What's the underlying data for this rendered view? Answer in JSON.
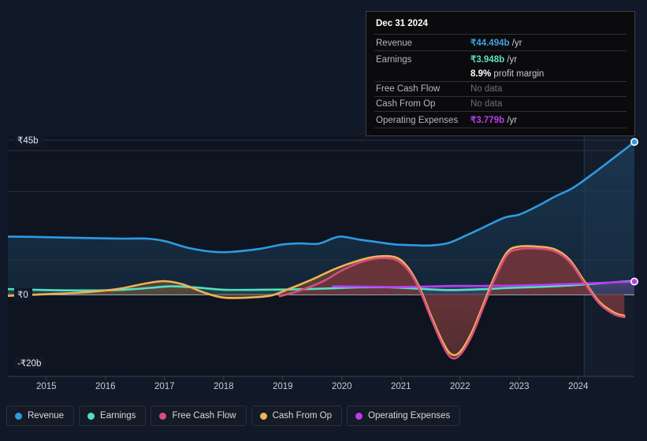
{
  "tooltip": {
    "date": "Dec 31 2024",
    "rows": [
      {
        "label": "Revenue",
        "value": "₹44.494b",
        "unit": "/yr",
        "color": "#3ea0e0",
        "nodata": false
      },
      {
        "label": "Earnings",
        "value": "₹3.948b",
        "unit": "/yr",
        "color": "#5fe0c0",
        "nodata": false
      },
      {
        "label": "",
        "value": "8.9%",
        "unit": "profit margin",
        "color": "#ffffff",
        "nodata": false
      },
      {
        "label": "Free Cash Flow",
        "value": "No data",
        "unit": "",
        "color": "#6b7079",
        "nodata": true
      },
      {
        "label": "Cash From Op",
        "value": "No data",
        "unit": "",
        "color": "#6b7079",
        "nodata": true
      },
      {
        "label": "Operating Expenses",
        "value": "₹3.779b",
        "unit": "/yr",
        "color": "#b83df0",
        "nodata": false
      }
    ]
  },
  "legend": [
    {
      "label": "Revenue",
      "color": "#2e9ae0"
    },
    {
      "label": "Earnings",
      "color": "#4fe0c4"
    },
    {
      "label": "Free Cash Flow",
      "color": "#d44d7d"
    },
    {
      "label": "Cash From Op",
      "color": "#f0b254"
    },
    {
      "label": "Operating Expenses",
      "color": "#b83df0"
    }
  ],
  "chart_data": {
    "type": "area",
    "title": "",
    "xlabel": "",
    "ylabel": "",
    "currency": "₹",
    "unit": "b",
    "ylim": [
      -20,
      45
    ],
    "yticks": [
      {
        "label": "₹45b",
        "value": 45
      },
      {
        "label": "₹0",
        "value": 0
      },
      {
        "label": "-₹20b",
        "value": -20
      }
    ],
    "gridlines": [
      45,
      42,
      30,
      10,
      0
    ],
    "xlim": [
      2014.35,
      2024.95
    ],
    "xticks": [
      "2015",
      "2016",
      "2017",
      "2018",
      "2019",
      "2020",
      "2021",
      "2022",
      "2023",
      "2024"
    ],
    "legend_position": "bottom",
    "grid": true,
    "highlight_region": {
      "from": 2024.1,
      "to": 2024.95
    },
    "series": [
      {
        "name": "Revenue",
        "color": "#2e9ae0",
        "fill": "#1b3a55",
        "end_marker": true,
        "end_value": 44.494,
        "points": [
          [
            2014.35,
            16.9
          ],
          [
            2014.8,
            16.8
          ],
          [
            2015.3,
            16.6
          ],
          [
            2015.9,
            16.4
          ],
          [
            2016.3,
            16.3
          ],
          [
            2016.7,
            16.3
          ],
          [
            2017.0,
            15.6
          ],
          [
            2017.4,
            13.6
          ],
          [
            2017.8,
            12.5
          ],
          [
            2018.1,
            12.4
          ],
          [
            2018.6,
            13.3
          ],
          [
            2019.0,
            14.6
          ],
          [
            2019.3,
            14.9
          ],
          [
            2019.6,
            14.8
          ],
          [
            2019.85,
            16.4
          ],
          [
            2020.0,
            16.9
          ],
          [
            2020.3,
            16.0
          ],
          [
            2020.6,
            15.3
          ],
          [
            2020.9,
            14.6
          ],
          [
            2021.2,
            14.4
          ],
          [
            2021.5,
            14.3
          ],
          [
            2021.8,
            15.0
          ],
          [
            2022.1,
            17.2
          ],
          [
            2022.4,
            19.6
          ],
          [
            2022.75,
            22.4
          ],
          [
            2023.0,
            23.3
          ],
          [
            2023.3,
            25.7
          ],
          [
            2023.6,
            28.5
          ],
          [
            2023.9,
            31.0
          ],
          [
            2024.2,
            34.6
          ],
          [
            2024.5,
            38.5
          ],
          [
            2024.75,
            41.8
          ],
          [
            2024.95,
            44.494
          ]
        ]
      },
      {
        "name": "Earnings",
        "color": "#4fe0c4",
        "fill": "#2a5a52",
        "points": [
          [
            2014.35,
            1.6
          ],
          [
            2015.0,
            1.3
          ],
          [
            2015.6,
            1.2
          ],
          [
            2016.2,
            1.3
          ],
          [
            2016.8,
            2.0
          ],
          [
            2017.1,
            2.4
          ],
          [
            2017.5,
            2.1
          ],
          [
            2018.0,
            1.4
          ],
          [
            2018.6,
            1.4
          ],
          [
            2019.2,
            1.5
          ],
          [
            2019.8,
            1.8
          ],
          [
            2020.3,
            2.1
          ],
          [
            2020.8,
            2.1
          ],
          [
            2021.3,
            1.7
          ],
          [
            2021.8,
            1.3
          ],
          [
            2022.3,
            1.5
          ],
          [
            2022.8,
            1.9
          ],
          [
            2023.3,
            2.2
          ],
          [
            2023.8,
            2.6
          ],
          [
            2024.3,
            3.2
          ],
          [
            2024.7,
            3.7
          ],
          [
            2024.95,
            3.948
          ]
        ]
      },
      {
        "name": "Free Cash Flow",
        "color": "#d44d7d",
        "fill": "#6e2f3c",
        "points": [
          [
            2018.95,
            -0.5
          ],
          [
            2019.3,
            1.2
          ],
          [
            2019.7,
            4.0
          ],
          [
            2020.0,
            7.0
          ],
          [
            2020.35,
            9.6
          ],
          [
            2020.65,
            10.6
          ],
          [
            2020.9,
            10.2
          ],
          [
            2021.1,
            7.6
          ],
          [
            2021.3,
            2.0
          ],
          [
            2021.5,
            -6.5
          ],
          [
            2021.7,
            -14.5
          ],
          [
            2021.85,
            -18.4
          ],
          [
            2022.0,
            -17.6
          ],
          [
            2022.2,
            -12.0
          ],
          [
            2022.4,
            -3.5
          ],
          [
            2022.6,
            5.0
          ],
          [
            2022.8,
            11.6
          ],
          [
            2023.0,
            13.2
          ],
          [
            2023.3,
            13.4
          ],
          [
            2023.6,
            12.6
          ],
          [
            2023.85,
            9.6
          ],
          [
            2024.1,
            3.5
          ],
          [
            2024.35,
            -2.5
          ],
          [
            2024.6,
            -5.7
          ],
          [
            2024.78,
            -6.6
          ]
        ]
      },
      {
        "name": "Cash From Op",
        "color": "#f0b254",
        "fill": "#6b4a33",
        "points": [
          [
            2014.35,
            -0.4
          ],
          [
            2015.0,
            0.1
          ],
          [
            2015.6,
            0.6
          ],
          [
            2016.2,
            1.6
          ],
          [
            2016.7,
            3.3
          ],
          [
            2017.0,
            3.9
          ],
          [
            2017.3,
            3.0
          ],
          [
            2017.7,
            0.4
          ],
          [
            2018.0,
            -0.9
          ],
          [
            2018.4,
            -0.9
          ],
          [
            2018.8,
            -0.3
          ],
          [
            2019.1,
            1.6
          ],
          [
            2019.5,
            4.4
          ],
          [
            2019.9,
            7.6
          ],
          [
            2020.3,
            10.0
          ],
          [
            2020.6,
            11.1
          ],
          [
            2020.9,
            10.9
          ],
          [
            2021.1,
            8.3
          ],
          [
            2021.3,
            2.6
          ],
          [
            2021.5,
            -5.8
          ],
          [
            2021.7,
            -13.6
          ],
          [
            2021.85,
            -17.4
          ],
          [
            2022.0,
            -16.7
          ],
          [
            2022.2,
            -11.0
          ],
          [
            2022.4,
            -2.6
          ],
          [
            2022.6,
            5.9
          ],
          [
            2022.8,
            12.4
          ],
          [
            2023.0,
            14.0
          ],
          [
            2023.3,
            14.0
          ],
          [
            2023.6,
            13.2
          ],
          [
            2023.85,
            10.2
          ],
          [
            2024.1,
            4.0
          ],
          [
            2024.35,
            -2.0
          ],
          [
            2024.6,
            -5.2
          ],
          [
            2024.78,
            -6.2
          ]
        ]
      },
      {
        "name": "Operating Expenses",
        "color": "#b83df0",
        "fill": "#4a3a7a",
        "end_marker": true,
        "end_value": 3.779,
        "points": [
          [
            2019.85,
            2.4
          ],
          [
            2020.4,
            2.3
          ],
          [
            2020.9,
            2.2
          ],
          [
            2021.4,
            2.3
          ],
          [
            2021.9,
            2.5
          ],
          [
            2022.4,
            2.5
          ],
          [
            2022.9,
            2.6
          ],
          [
            2023.4,
            2.8
          ],
          [
            2023.9,
            3.1
          ],
          [
            2024.4,
            3.4
          ],
          [
            2024.95,
            3.779
          ]
        ]
      }
    ]
  }
}
